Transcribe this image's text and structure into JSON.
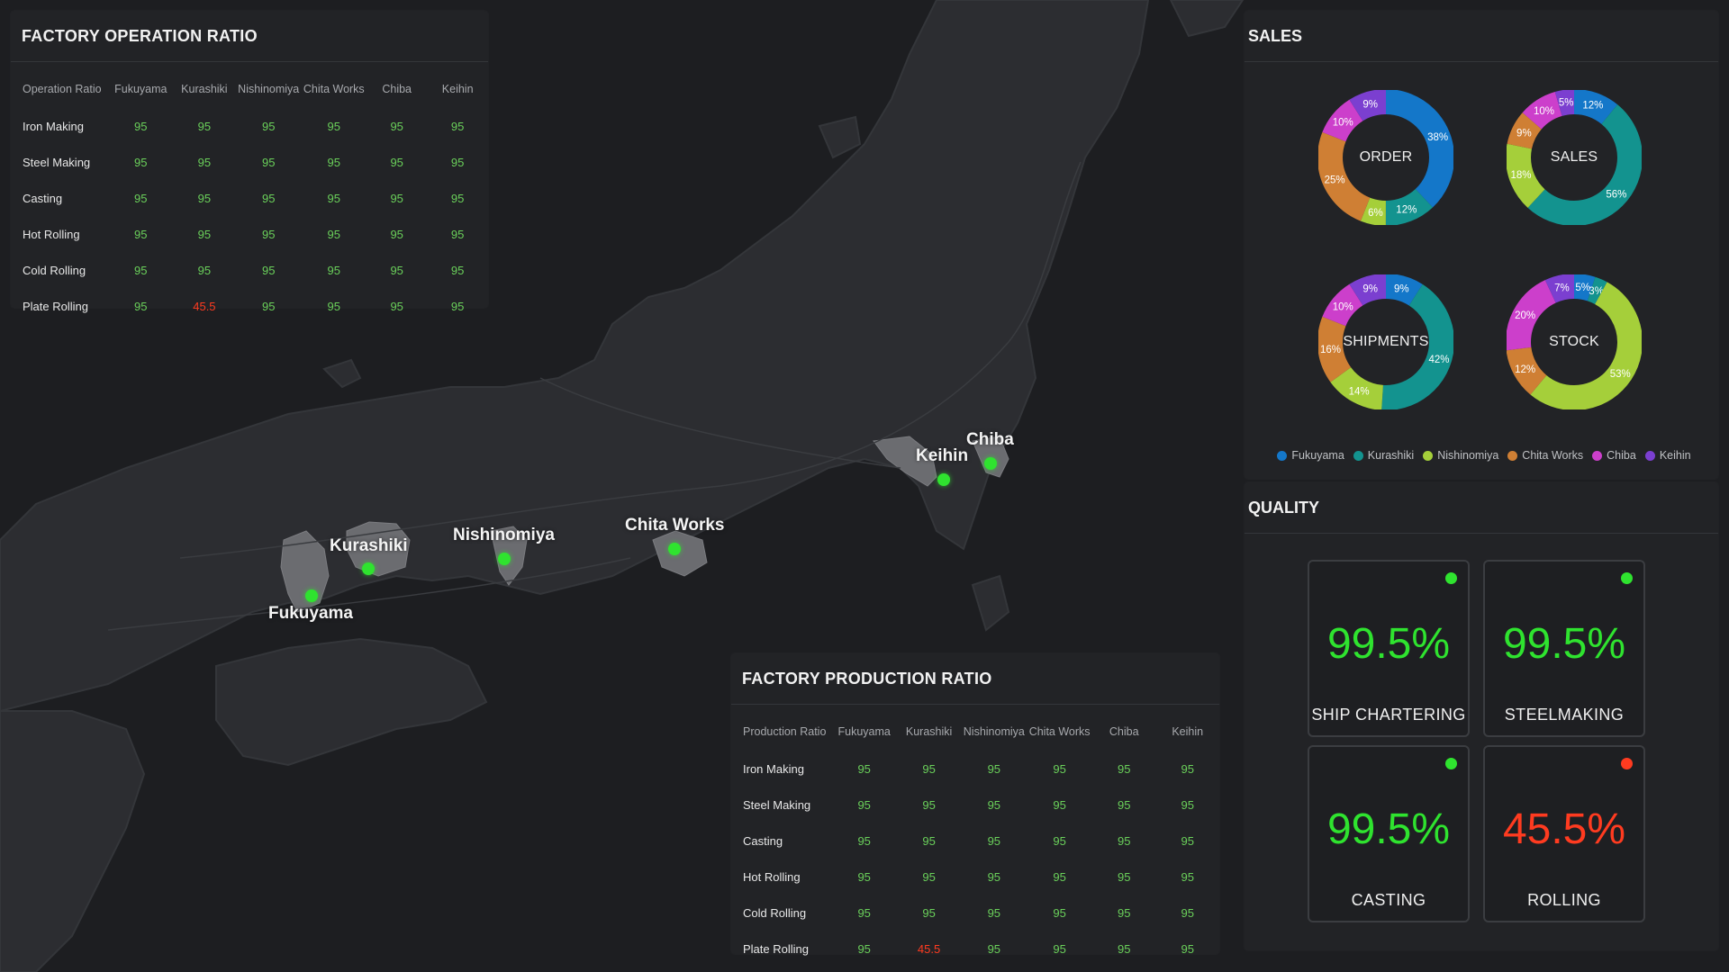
{
  "operation": {
    "title": "FACTORY OPERATION RATIO",
    "headers": [
      "Operation Ratio",
      "Fukuyama",
      "Kurashiki",
      "Nishinomiya",
      "Chita Works",
      "Chiba",
      "Keihin"
    ],
    "rows": [
      {
        "label": "Iron Making",
        "values": [
          "95",
          "95",
          "95",
          "95",
          "95",
          "95"
        ]
      },
      {
        "label": "Steel Making",
        "values": [
          "95",
          "95",
          "95",
          "95",
          "95",
          "95"
        ]
      },
      {
        "label": "Casting",
        "values": [
          "95",
          "95",
          "95",
          "95",
          "95",
          "95"
        ]
      },
      {
        "label": "Hot Rolling",
        "values": [
          "95",
          "95",
          "95",
          "95",
          "95",
          "95"
        ]
      },
      {
        "label": "Cold Rolling",
        "values": [
          "95",
          "95",
          "95",
          "95",
          "95",
          "95"
        ]
      },
      {
        "label": "Plate Rolling",
        "values": [
          "95",
          "45.5",
          "95",
          "95",
          "95",
          "95"
        ]
      }
    ]
  },
  "production": {
    "title": "FACTORY PRODUCTION RATIO",
    "headers": [
      "Production Ratio",
      "Fukuyama",
      "Kurashiki",
      "Nishinomiya",
      "Chita Works",
      "Chiba",
      "Keihin"
    ],
    "rows": [
      {
        "label": "Iron Making",
        "values": [
          "95",
          "95",
          "95",
          "95",
          "95",
          "95"
        ]
      },
      {
        "label": "Steel Making",
        "values": [
          "95",
          "95",
          "95",
          "95",
          "95",
          "95"
        ]
      },
      {
        "label": "Casting",
        "values": [
          "95",
          "95",
          "95",
          "95",
          "95",
          "95"
        ]
      },
      {
        "label": "Hot Rolling",
        "values": [
          "95",
          "95",
          "95",
          "95",
          "95",
          "95"
        ]
      },
      {
        "label": "Cold Rolling",
        "values": [
          "95",
          "95",
          "95",
          "95",
          "95",
          "95"
        ]
      },
      {
        "label": "Plate Rolling",
        "values": [
          "95",
          "45.5",
          "95",
          "95",
          "95",
          "95"
        ]
      }
    ]
  },
  "map": {
    "places": [
      "Fukuyama",
      "Kurashiki",
      "Nishinomiya",
      "Chita Works",
      "Keihin",
      "Chiba"
    ]
  },
  "sales": {
    "title": "SALES",
    "colors": {
      "Fukuyama": "#1477c9",
      "Kurashiki": "#13938f",
      "Nishinomiya": "#a5cf3a",
      "Chita Works": "#cf7f34",
      "Chiba": "#cc3fcb",
      "Keihin": "#7b3fd0"
    },
    "legend": [
      "Fukuyama",
      "Kurashiki",
      "Nishinomiya",
      "Chita Works",
      "Chiba",
      "Keihin"
    ],
    "donuts": [
      {
        "title": "ORDER",
        "segments": [
          {
            "name": "Fukuyama",
            "pct": 38,
            "label": "38%"
          },
          {
            "name": "Kurashiki",
            "pct": 12,
            "label": "12%"
          },
          {
            "name": "Nishinomiya",
            "pct": 6,
            "label": "6%"
          },
          {
            "name": "Chita Works",
            "pct": 25,
            "label": "25%"
          },
          {
            "name": "Chiba",
            "pct": 10,
            "label": "10%"
          },
          {
            "name": "Keihin",
            "pct": 9,
            "label": "9%"
          }
        ]
      },
      {
        "title": "SALES",
        "segments": [
          {
            "name": "Fukuyama",
            "pct": 12,
            "label": "12%"
          },
          {
            "name": "Kurashiki",
            "pct": 56,
            "label": "56%"
          },
          {
            "name": "Nishinomiya",
            "pct": 18,
            "label": "18%"
          },
          {
            "name": "Chita Works",
            "pct": 9,
            "label": "9%"
          },
          {
            "name": "Chiba",
            "pct": 10,
            "label": "10%"
          },
          {
            "name": "Keihin",
            "pct": 5,
            "label": "5%"
          }
        ]
      },
      {
        "title": "SHIPMENTS",
        "segments": [
          {
            "name": "Fukuyama",
            "pct": 9,
            "label": "9%"
          },
          {
            "name": "Kurashiki",
            "pct": 42,
            "label": "42%"
          },
          {
            "name": "Nishinomiya",
            "pct": 14,
            "label": "14%"
          },
          {
            "name": "Chita Works",
            "pct": 16,
            "label": "16%"
          },
          {
            "name": "Chiba",
            "pct": 10,
            "label": "10%"
          },
          {
            "name": "Keihin",
            "pct": 9,
            "label": "9%"
          }
        ]
      },
      {
        "title": "STOCK",
        "segments": [
          {
            "name": "Fukuyama",
            "pct": 5,
            "label": "5%"
          },
          {
            "name": "Kurashiki",
            "pct": 3,
            "label": "3%"
          },
          {
            "name": "Nishinomiya",
            "pct": 53,
            "label": "53%"
          },
          {
            "name": "Chita Works",
            "pct": 12,
            "label": "12%"
          },
          {
            "name": "Chiba",
            "pct": 20,
            "label": "20%"
          },
          {
            "name": "Keihin",
            "pct": 7,
            "label": "7%"
          }
        ]
      }
    ]
  },
  "quality": {
    "title": "QUALITY",
    "cards": [
      {
        "value": "99.5%",
        "label": "SHIP CHARTERING",
        "status": "good"
      },
      {
        "value": "99.5%",
        "label": "STEELMAKING",
        "status": "good"
      },
      {
        "value": "99.5%",
        "label": "CASTING",
        "status": "good"
      },
      {
        "value": "45.5%",
        "label": "ROLLING",
        "status": "bad"
      }
    ],
    "status_colors": {
      "good": "#2fe32f",
      "bad": "#ff3b20"
    }
  }
}
